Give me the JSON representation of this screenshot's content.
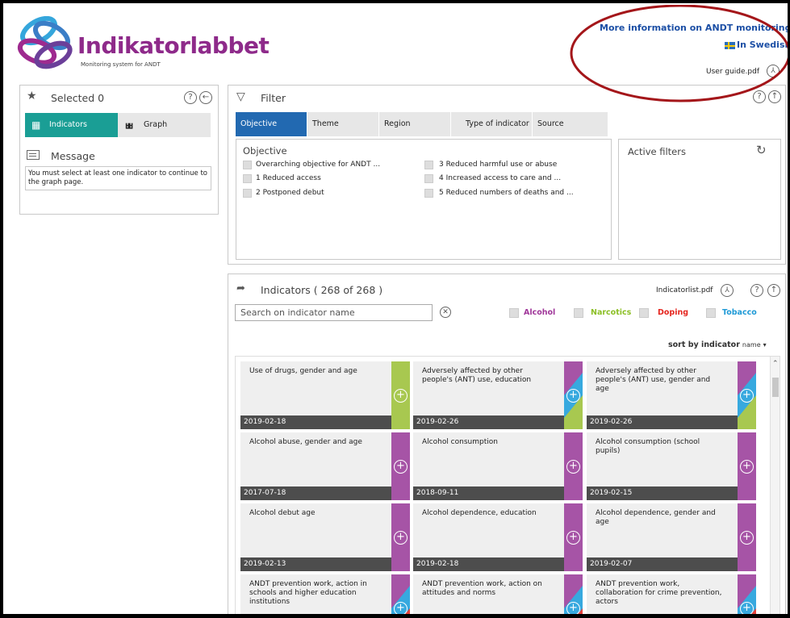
{
  "header": {
    "logo_title": "Indikatorlabbet",
    "logo_subtitle": "Monitoring system for ANDT",
    "more_info_link": "More information on ANDT monitoring",
    "swedish_link": "In Swedish",
    "user_guide_link": "User guide.pdf"
  },
  "selected_panel": {
    "title": "Selected 0",
    "tab_indicators": "Indicators",
    "tab_graph": "Graph",
    "message_title": "Message",
    "message_text": "You must select at least one indicator to continue to the graph page."
  },
  "filter_panel": {
    "title": "Filter",
    "tabs": [
      "Objective",
      "Theme",
      "Region",
      "Type of indicator",
      "Source"
    ],
    "objective_heading": "Objective",
    "objectives": [
      "Overarching objective for ANDT ...",
      "1 Reduced access",
      "2 Postponed debut",
      "3 Reduced harmful use or abuse",
      "4 Increased access to care and ...",
      "5 Reduced numbers of deaths and ..."
    ],
    "active_filters_title": "Active filters"
  },
  "indicators_panel": {
    "title": "Indicators ( 268 of 268 )",
    "list_pdf": "Indicatorlist.pdf",
    "search_placeholder": "Search on indicator name",
    "legend": [
      {
        "label": "Alcohol",
        "color": "#a0379a"
      },
      {
        "label": "Narcotics",
        "color": "#8cbf26"
      },
      {
        "label": "Doping",
        "color": "#e5261f"
      },
      {
        "label": "Tobacco",
        "color": "#1f9ad6"
      }
    ],
    "sort_label": "sort by indicator",
    "sort_value": "name",
    "cards": [
      {
        "title": "Use of drugs, gender and age",
        "date": "2019-02-18",
        "categories": [
          "narcotics"
        ]
      },
      {
        "title": "Adversely affected by other people's (ANT) use, education",
        "date": "2019-02-26",
        "categories": [
          "alcohol",
          "tobacco",
          "narcotics"
        ]
      },
      {
        "title": "Adversely affected by other people's (ANT) use, gender and age",
        "date": "2019-02-26",
        "categories": [
          "alcohol",
          "tobacco",
          "narcotics"
        ]
      },
      {
        "title": "Alcohol abuse, gender and age",
        "date": "2017-07-18",
        "categories": [
          "alcohol"
        ]
      },
      {
        "title": "Alcohol consumption",
        "date": "2018-09-11",
        "categories": [
          "alcohol"
        ]
      },
      {
        "title": "Alcohol consumption (school pupils)",
        "date": "2019-02-15",
        "categories": [
          "alcohol"
        ]
      },
      {
        "title": "Alcohol debut age",
        "date": "2019-02-13",
        "categories": [
          "alcohol"
        ]
      },
      {
        "title": "Alcohol dependence, education",
        "date": "2019-02-18",
        "categories": [
          "alcohol"
        ]
      },
      {
        "title": "Alcohol dependence, gender and age",
        "date": "2019-02-07",
        "categories": [
          "alcohol"
        ]
      },
      {
        "title": "ANDT prevention work, action in schools and higher education institutions",
        "date": "",
        "categories": [
          "alcohol",
          "tobacco",
          "doping"
        ]
      },
      {
        "title": "ANDT prevention work, action on attitudes and norms",
        "date": "",
        "categories": [
          "alcohol",
          "tobacco",
          "doping"
        ]
      },
      {
        "title": "ANDT prevention work, collaboration for crime prevention, actors",
        "date": "",
        "categories": [
          "alcohol",
          "tobacco",
          "doping"
        ]
      }
    ]
  },
  "colors": {
    "alcohol": "#a654a6",
    "narcotics": "#a8c850",
    "doping": "#e5413b",
    "tobacco": "#37a9df",
    "teal_tab": "#1a9e95",
    "blue_tab": "#2269b1",
    "annotation_ellipse": "#a4161a"
  },
  "icons": [
    "star-icon",
    "help-icon",
    "back-icon",
    "grid-icon",
    "chart-icon",
    "message-icon",
    "filter-icon",
    "reset-icon",
    "arrow-icon",
    "clear-icon",
    "pdf-icon",
    "up-icon",
    "plus-icon",
    "sweden-flag-icon"
  ]
}
